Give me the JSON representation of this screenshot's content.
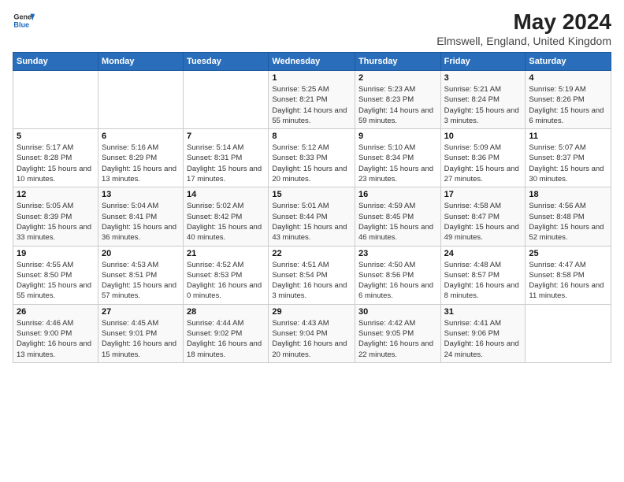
{
  "logo": {
    "general": "General",
    "blue": "Blue"
  },
  "title": "May 2024",
  "subtitle": "Elmswell, England, United Kingdom",
  "days_of_week": [
    "Sunday",
    "Monday",
    "Tuesday",
    "Wednesday",
    "Thursday",
    "Friday",
    "Saturday"
  ],
  "weeks": [
    [
      {
        "day": "",
        "info": ""
      },
      {
        "day": "",
        "info": ""
      },
      {
        "day": "",
        "info": ""
      },
      {
        "day": "1",
        "info": "Sunrise: 5:25 AM\nSunset: 8:21 PM\nDaylight: 14 hours and 55 minutes."
      },
      {
        "day": "2",
        "info": "Sunrise: 5:23 AM\nSunset: 8:23 PM\nDaylight: 14 hours and 59 minutes."
      },
      {
        "day": "3",
        "info": "Sunrise: 5:21 AM\nSunset: 8:24 PM\nDaylight: 15 hours and 3 minutes."
      },
      {
        "day": "4",
        "info": "Sunrise: 5:19 AM\nSunset: 8:26 PM\nDaylight: 15 hours and 6 minutes."
      }
    ],
    [
      {
        "day": "5",
        "info": "Sunrise: 5:17 AM\nSunset: 8:28 PM\nDaylight: 15 hours and 10 minutes."
      },
      {
        "day": "6",
        "info": "Sunrise: 5:16 AM\nSunset: 8:29 PM\nDaylight: 15 hours and 13 minutes."
      },
      {
        "day": "7",
        "info": "Sunrise: 5:14 AM\nSunset: 8:31 PM\nDaylight: 15 hours and 17 minutes."
      },
      {
        "day": "8",
        "info": "Sunrise: 5:12 AM\nSunset: 8:33 PM\nDaylight: 15 hours and 20 minutes."
      },
      {
        "day": "9",
        "info": "Sunrise: 5:10 AM\nSunset: 8:34 PM\nDaylight: 15 hours and 23 minutes."
      },
      {
        "day": "10",
        "info": "Sunrise: 5:09 AM\nSunset: 8:36 PM\nDaylight: 15 hours and 27 minutes."
      },
      {
        "day": "11",
        "info": "Sunrise: 5:07 AM\nSunset: 8:37 PM\nDaylight: 15 hours and 30 minutes."
      }
    ],
    [
      {
        "day": "12",
        "info": "Sunrise: 5:05 AM\nSunset: 8:39 PM\nDaylight: 15 hours and 33 minutes."
      },
      {
        "day": "13",
        "info": "Sunrise: 5:04 AM\nSunset: 8:41 PM\nDaylight: 15 hours and 36 minutes."
      },
      {
        "day": "14",
        "info": "Sunrise: 5:02 AM\nSunset: 8:42 PM\nDaylight: 15 hours and 40 minutes."
      },
      {
        "day": "15",
        "info": "Sunrise: 5:01 AM\nSunset: 8:44 PM\nDaylight: 15 hours and 43 minutes."
      },
      {
        "day": "16",
        "info": "Sunrise: 4:59 AM\nSunset: 8:45 PM\nDaylight: 15 hours and 46 minutes."
      },
      {
        "day": "17",
        "info": "Sunrise: 4:58 AM\nSunset: 8:47 PM\nDaylight: 15 hours and 49 minutes."
      },
      {
        "day": "18",
        "info": "Sunrise: 4:56 AM\nSunset: 8:48 PM\nDaylight: 15 hours and 52 minutes."
      }
    ],
    [
      {
        "day": "19",
        "info": "Sunrise: 4:55 AM\nSunset: 8:50 PM\nDaylight: 15 hours and 55 minutes."
      },
      {
        "day": "20",
        "info": "Sunrise: 4:53 AM\nSunset: 8:51 PM\nDaylight: 15 hours and 57 minutes."
      },
      {
        "day": "21",
        "info": "Sunrise: 4:52 AM\nSunset: 8:53 PM\nDaylight: 16 hours and 0 minutes."
      },
      {
        "day": "22",
        "info": "Sunrise: 4:51 AM\nSunset: 8:54 PM\nDaylight: 16 hours and 3 minutes."
      },
      {
        "day": "23",
        "info": "Sunrise: 4:50 AM\nSunset: 8:56 PM\nDaylight: 16 hours and 6 minutes."
      },
      {
        "day": "24",
        "info": "Sunrise: 4:48 AM\nSunset: 8:57 PM\nDaylight: 16 hours and 8 minutes."
      },
      {
        "day": "25",
        "info": "Sunrise: 4:47 AM\nSunset: 8:58 PM\nDaylight: 16 hours and 11 minutes."
      }
    ],
    [
      {
        "day": "26",
        "info": "Sunrise: 4:46 AM\nSunset: 9:00 PM\nDaylight: 16 hours and 13 minutes."
      },
      {
        "day": "27",
        "info": "Sunrise: 4:45 AM\nSunset: 9:01 PM\nDaylight: 16 hours and 15 minutes."
      },
      {
        "day": "28",
        "info": "Sunrise: 4:44 AM\nSunset: 9:02 PM\nDaylight: 16 hours and 18 minutes."
      },
      {
        "day": "29",
        "info": "Sunrise: 4:43 AM\nSunset: 9:04 PM\nDaylight: 16 hours and 20 minutes."
      },
      {
        "day": "30",
        "info": "Sunrise: 4:42 AM\nSunset: 9:05 PM\nDaylight: 16 hours and 22 minutes."
      },
      {
        "day": "31",
        "info": "Sunrise: 4:41 AM\nSunset: 9:06 PM\nDaylight: 16 hours and 24 minutes."
      },
      {
        "day": "",
        "info": ""
      }
    ]
  ]
}
